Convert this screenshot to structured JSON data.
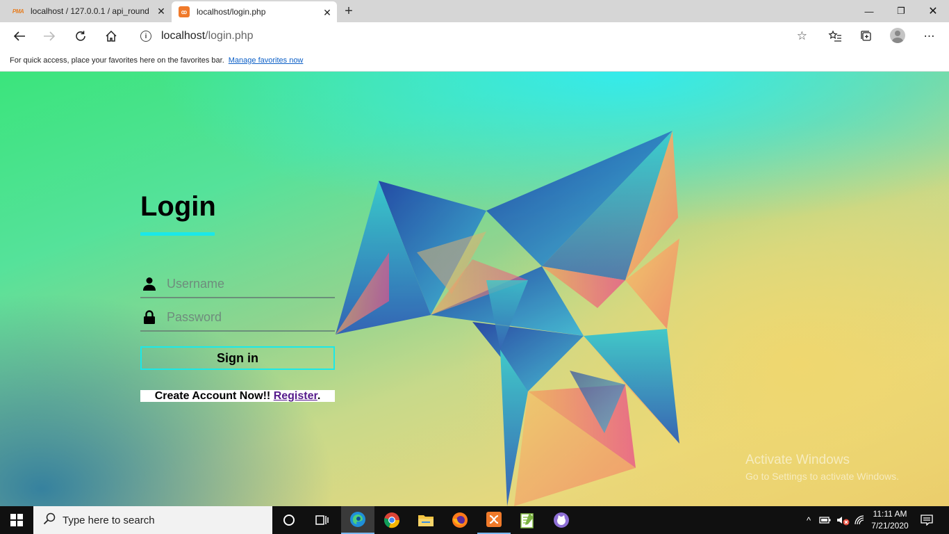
{
  "browser": {
    "tabs": [
      {
        "title": "localhost / 127.0.0.1 / api_round",
        "icon": "phpmyadmin-icon",
        "active": false
      },
      {
        "title": "localhost/login.php",
        "icon": "xampp-icon",
        "active": true
      }
    ],
    "address": {
      "host": "localhost",
      "path": "/login.php"
    },
    "favorites_bar": {
      "message": "For quick access, place your favorites here on the favorites bar.",
      "link": "Manage favorites now"
    }
  },
  "login": {
    "title": "Login",
    "username_placeholder": "Username",
    "password_placeholder": "Password",
    "signin_label": "Sign in",
    "create_text": "Create Account Now!!",
    "register_link": "Register",
    "period": "."
  },
  "watermark": {
    "line1": "Activate Windows",
    "line2": "Go to Settings to activate Windows."
  },
  "taskbar": {
    "search_placeholder": "Type here to search",
    "clock_time": "11:11 AM",
    "clock_date": "7/21/2020"
  },
  "colors": {
    "accent": "#1be8e8",
    "register_link": "#551a8b",
    "favorites_link": "#0b5fc7"
  }
}
